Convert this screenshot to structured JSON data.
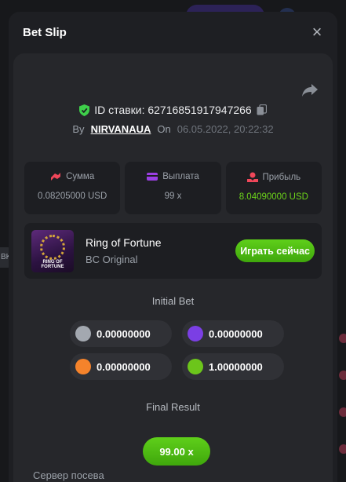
{
  "modal": {
    "title": "Bet Slip",
    "close": "×"
  },
  "bet": {
    "id_label": "ID ставки: 62716851917947266",
    "by_label": "By",
    "user": "NIRVANAUA",
    "on_label": "On",
    "datetime": "06.05.2022, 20:22:32"
  },
  "stats": [
    {
      "label": "Сумма",
      "value": "0.08205000 USD",
      "icon": "money-icon"
    },
    {
      "label": "Выплата",
      "value": "99 x",
      "icon": "wallet-icon"
    },
    {
      "label": "Прибыль",
      "value": "8.04090000 USD",
      "icon": "profit-icon"
    }
  ],
  "game": {
    "name": "Ring of Fortune",
    "provider": "BC Original",
    "thumb_text": "RING OF FORTUNE",
    "play_label": "Играть сейчас"
  },
  "initial_bet": {
    "title": "Initial Bet",
    "items": [
      {
        "color": "#a3a8b0",
        "value": "0.00000000"
      },
      {
        "color": "#7b3fe4",
        "value": "0.00000000"
      },
      {
        "color": "#f5832b",
        "value": "0.00000000"
      },
      {
        "color": "#6cc51b",
        "value": "1.00000000"
      }
    ]
  },
  "final_result": {
    "title": "Final Result",
    "value": "99.00 x"
  },
  "seed": {
    "label": "Сервер посева"
  },
  "background": {
    "edge_text": "BK"
  },
  "colors": {
    "accent_green": "#5fcf1a",
    "profit_green": "#6cd31a",
    "shield_green": "#3ecf4a",
    "icon_red": "#f0475a",
    "icon_purple": "#9b3fe4"
  }
}
